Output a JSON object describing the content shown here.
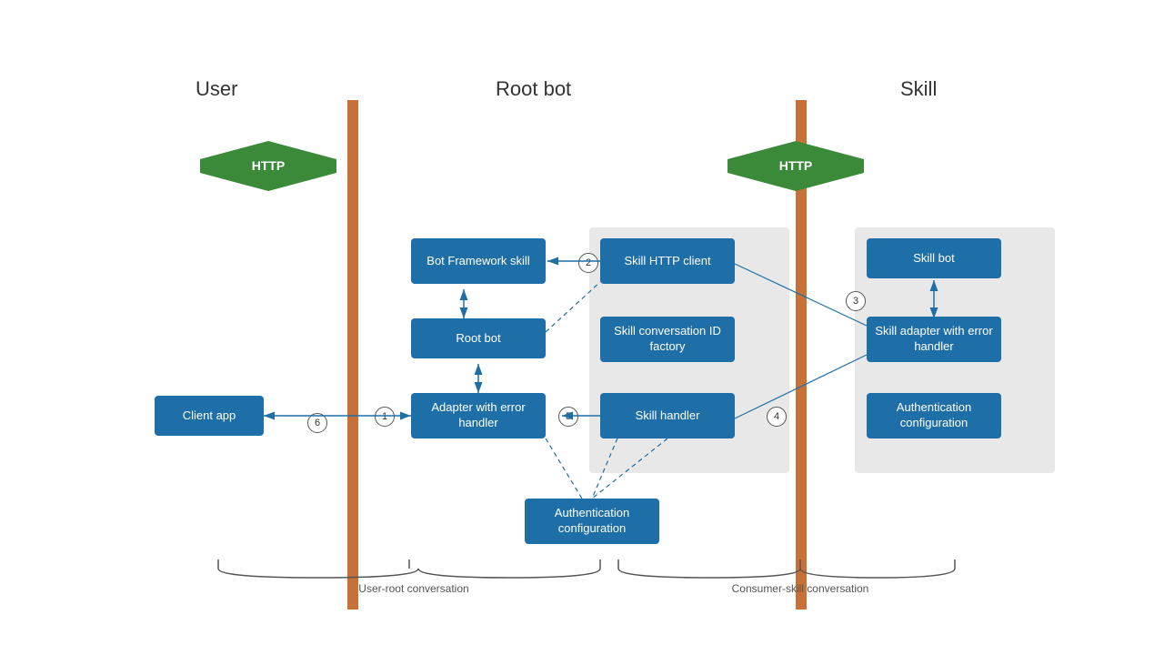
{
  "labels": {
    "user": "User",
    "root_bot": "Root bot",
    "skill": "Skill",
    "user_root_conversation": "User-root conversation",
    "consumer_skill_conversation": "Consumer-skill conversation",
    "http": "HTTP"
  },
  "boxes": {
    "client_app": "Client app",
    "bot_framework_skill": "Bot Framework skill",
    "root_bot": "Root bot",
    "adapter_with_error_handler": "Adapter with error handler",
    "skill_http_client": "Skill HTTP client",
    "skill_conversation_id_factory": "Skill conversation ID factory",
    "skill_handler": "Skill handler",
    "auth_config_bottom": "Authentication configuration",
    "skill_bot": "Skill bot",
    "skill_adapter_with_error_handler": "Skill adapter with error handler",
    "auth_config_right": "Authentication configuration"
  },
  "numbers": [
    "1",
    "2",
    "3",
    "4",
    "5",
    "6"
  ]
}
